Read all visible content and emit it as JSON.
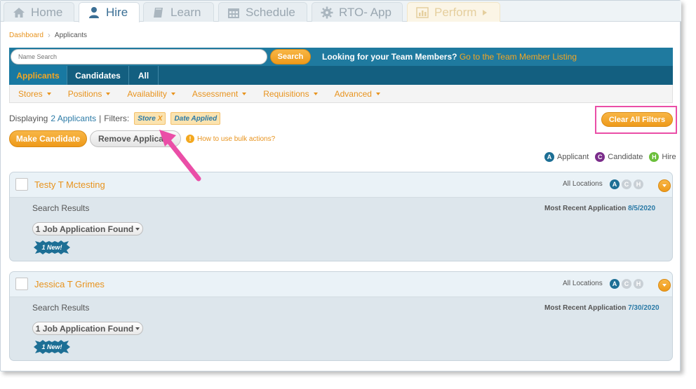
{
  "nav": {
    "tabs": [
      {
        "label": "Home",
        "icon": "home-icon"
      },
      {
        "label": "Hire",
        "icon": "person-icon"
      },
      {
        "label": "Learn",
        "icon": "book-icon"
      },
      {
        "label": "Schedule",
        "icon": "calendar-icon"
      },
      {
        "label": "RTO- App",
        "icon": "gear-icon"
      },
      {
        "label": "Perform",
        "icon": "chart-icon"
      }
    ],
    "active": "Hire"
  },
  "breadcrumb": {
    "root": "Dashboard",
    "current": "Applicants"
  },
  "search": {
    "placeholder": "Name Search",
    "button": "Search",
    "message": "Looking for your Team Members?",
    "message_link": "Go to the Team Member Listing"
  },
  "view_tabs": [
    "Applicants",
    "Candidates",
    "All"
  ],
  "filter_menu": [
    "Stores",
    "Positions",
    "Availability",
    "Assessment",
    "Requisitions",
    "Advanced"
  ],
  "display": {
    "prefix": "Displaying",
    "count": "2 Applicants",
    "sep": "|",
    "filters_label": "Filters:",
    "chips": [
      {
        "label": "Store",
        "remove": "X"
      },
      {
        "label": "Date Applied"
      }
    ]
  },
  "actions": {
    "clear_all": "Clear All Filters",
    "make_candidate": "Make Candidate",
    "remove_applicant": "Remove Applicant",
    "help": "How to use bulk actions?"
  },
  "legend": [
    {
      "letter": "A",
      "label": "Applicant",
      "color": "#1d6f95"
    },
    {
      "letter": "C",
      "label": "Candidate",
      "color": "#7b2d8b"
    },
    {
      "letter": "H",
      "label": "Hire",
      "color": "#6bbf3b"
    }
  ],
  "applicants": [
    {
      "name": "Testy T Mctesting",
      "locations": "All Locations",
      "status_badges": [
        "A",
        "C",
        "H"
      ],
      "search_results": "Search Results",
      "recent_label": "Most Recent Application",
      "recent_date": "8/5/2020",
      "jobs": "1 Job Application Found",
      "new_badge": "1 New!"
    },
    {
      "name": "Jessica T Grimes",
      "locations": "All Locations",
      "status_badges": [
        "A",
        "C",
        "H"
      ],
      "search_results": "Search Results",
      "recent_label": "Most Recent Application",
      "recent_date": "7/30/2020",
      "jobs": "1 Job Application Found",
      "new_badge": "1 New!"
    }
  ],
  "colors": {
    "accent": "#e8931d",
    "brand": "#1f7a9f",
    "highlight": "#ea4ea7"
  }
}
